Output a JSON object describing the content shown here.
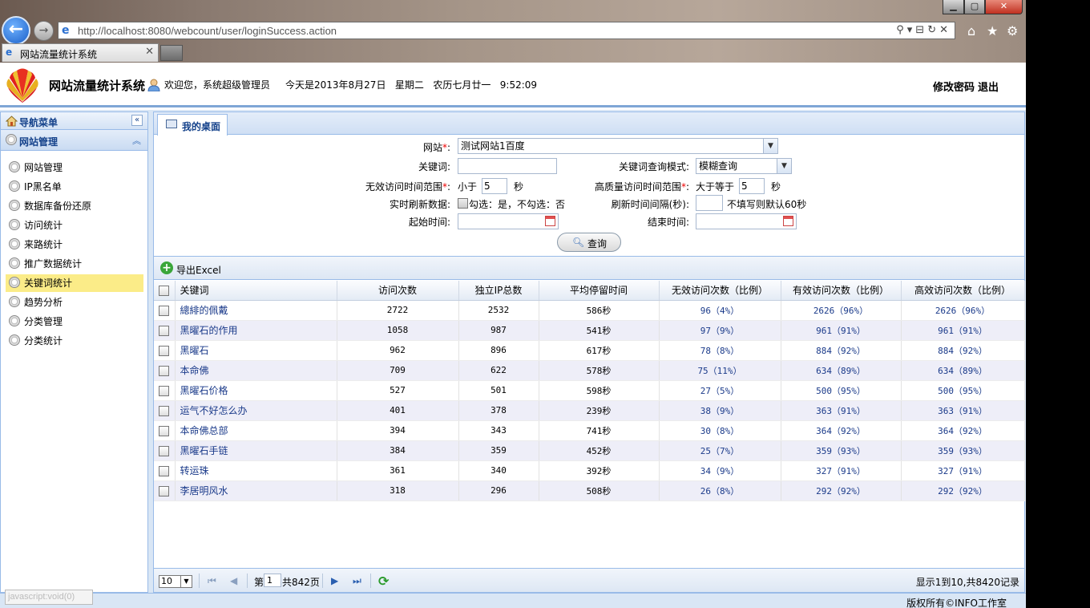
{
  "browser": {
    "url": "http://localhost:8080/webcount/user/loginSuccess.action",
    "tab_title": "网站流量统计系统",
    "status_text": "javascript:void(0)"
  },
  "header": {
    "title": "网站流量统计系统",
    "welcome": "欢迎您，系统超级管理员",
    "date": "今天是2013年8月27日   星期二   农历七月廿一   9:52:09",
    "change_password": "修改密码",
    "logout": "退出"
  },
  "sidebar": {
    "nav_title": "导航菜单",
    "group_title": "网站管理",
    "items": [
      {
        "label": "网站管理"
      },
      {
        "label": "IP黑名单"
      },
      {
        "label": "数据库备份还原"
      },
      {
        "label": "访问统计"
      },
      {
        "label": "来路统计"
      },
      {
        "label": "推广数据统计"
      },
      {
        "label": "关键词统计"
      },
      {
        "label": "趋势分析"
      },
      {
        "label": "分类管理"
      },
      {
        "label": "分类统计"
      }
    ]
  },
  "main": {
    "tab_label": "我的桌面",
    "form": {
      "site_label": "网站",
      "site_value": "测试网站1百度",
      "keyword_label": "关键词:",
      "keyword_value": "",
      "mode_label": "关键词查询模式:",
      "mode_value": "模糊查询",
      "invalid_label": "无效访问时间范围",
      "invalid_prefix": "小于",
      "invalid_value": "5",
      "invalid_unit": "秒",
      "hq_label": "高质量访问时间范围",
      "hq_prefix": "大于等于",
      "hq_value": "5",
      "hq_unit": "秒",
      "refresh_label": "实时刷新数据:",
      "refresh_hint": "勾选：是，不勾选：否",
      "interval_label": "刷新时间间隔(秒):",
      "interval_hint": "不填写则默认60秒",
      "start_label": "起始时间:",
      "end_label": "结束时间:",
      "query_button": "查询"
    },
    "export_label": "导出Excel",
    "columns": [
      "关键词",
      "访问次数",
      "独立IP总数",
      "平均停留时间",
      "无效访问次数（比例）",
      "有效访问次数（比例）",
      "高效访问次数（比例）"
    ],
    "rows": [
      [
        "總緋的佩戴",
        "2722",
        "2532",
        "586秒",
        "96（4%）",
        "2626（96%）",
        "2626（96%）"
      ],
      [
        "黑曜石的作用",
        "1058",
        "987",
        "541秒",
        "97（9%）",
        "961（91%）",
        "961（91%）"
      ],
      [
        "黑曜石",
        "962",
        "896",
        "617秒",
        "78（8%）",
        "884（92%）",
        "884（92%）"
      ],
      [
        "本命佛",
        "709",
        "622",
        "578秒",
        "75（11%）",
        "634（89%）",
        "634（89%）"
      ],
      [
        "黑曜石价格",
        "527",
        "501",
        "598秒",
        "27（5%）",
        "500（95%）",
        "500（95%）"
      ],
      [
        "运气不好怎么办",
        "401",
        "378",
        "239秒",
        "38（9%）",
        "363（91%）",
        "363（91%）"
      ],
      [
        "本命佛总部",
        "394",
        "343",
        "741秒",
        "30（8%）",
        "364（92%）",
        "364（92%）"
      ],
      [
        "黑曜石手链",
        "384",
        "359",
        "452秒",
        "25（7%）",
        "359（93%）",
        "359（93%）"
      ],
      [
        "转运珠",
        "361",
        "340",
        "392秒",
        "34（9%）",
        "327（91%）",
        "327（91%）"
      ],
      [
        "李居明风水",
        "318",
        "296",
        "508秒",
        "26（8%）",
        "292（92%）",
        "292（92%）"
      ]
    ],
    "pager": {
      "page_size": "10",
      "page_prefix": "第",
      "page_value": "1",
      "page_total": "共842页",
      "info": "显示1到10,共8420记录"
    }
  },
  "footer": {
    "copyright": "版权所有©INFO工作室"
  },
  "colors": {
    "accent": "#99bbe8",
    "link": "#1a3a8a",
    "active_item": "#fbec88"
  }
}
